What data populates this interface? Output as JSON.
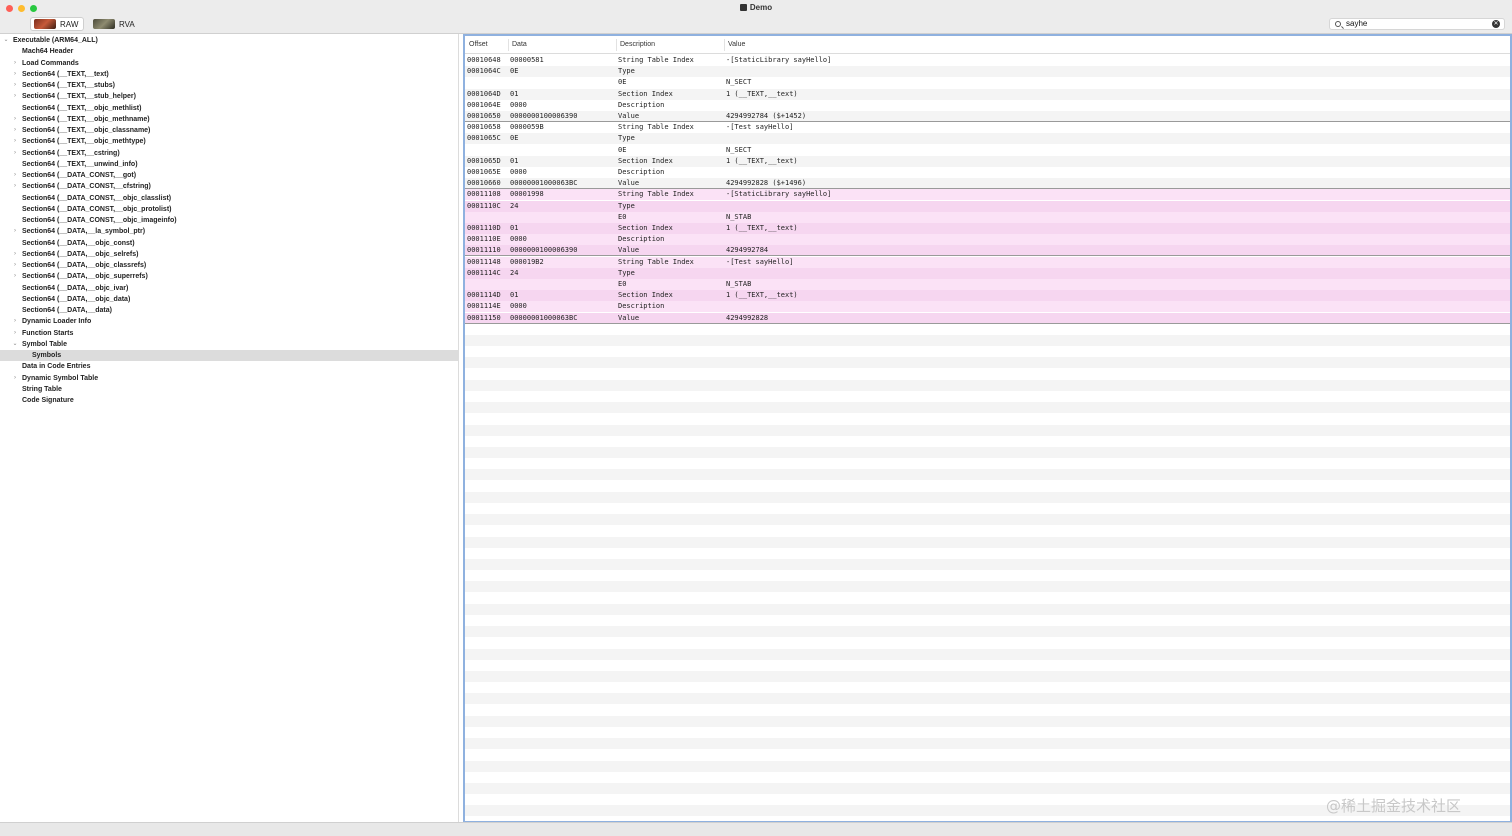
{
  "window": {
    "title": "Demo"
  },
  "toolbar": {
    "raw_label": "RAW",
    "rva_label": "RVA",
    "search_value": "sayhe"
  },
  "sidebar": {
    "items": [
      {
        "label": "Executable  (ARM64_ALL)",
        "expanded": true,
        "level": 0
      },
      {
        "label": "Mach64 Header",
        "level": 1
      },
      {
        "label": "Load Commands",
        "collapsed": true,
        "level": 1
      },
      {
        "label": "Section64 (__TEXT,__text)",
        "collapsed": true,
        "level": 1
      },
      {
        "label": "Section64 (__TEXT,__stubs)",
        "collapsed": true,
        "level": 1
      },
      {
        "label": "Section64 (__TEXT,__stub_helper)",
        "collapsed": true,
        "level": 1
      },
      {
        "label": "Section64 (__TEXT,__objc_methlist)",
        "level": 1
      },
      {
        "label": "Section64 (__TEXT,__objc_methname)",
        "collapsed": true,
        "level": 1
      },
      {
        "label": "Section64 (__TEXT,__objc_classname)",
        "collapsed": true,
        "level": 1
      },
      {
        "label": "Section64 (__TEXT,__objc_methtype)",
        "collapsed": true,
        "level": 1
      },
      {
        "label": "Section64 (__TEXT,__cstring)",
        "collapsed": true,
        "level": 1
      },
      {
        "label": "Section64 (__TEXT,__unwind_info)",
        "level": 1
      },
      {
        "label": "Section64 (__DATA_CONST,__got)",
        "collapsed": true,
        "level": 1
      },
      {
        "label": "Section64 (__DATA_CONST,__cfstring)",
        "collapsed": true,
        "level": 1
      },
      {
        "label": "Section64 (__DATA_CONST,__objc_classlist)",
        "level": 1
      },
      {
        "label": "Section64 (__DATA_CONST,__objc_protolist)",
        "level": 1
      },
      {
        "label": "Section64 (__DATA_CONST,__objc_imageinfo)",
        "level": 1
      },
      {
        "label": "Section64 (__DATA,__la_symbol_ptr)",
        "collapsed": true,
        "level": 1
      },
      {
        "label": "Section64 (__DATA,__objc_const)",
        "level": 1
      },
      {
        "label": "Section64 (__DATA,__objc_selrefs)",
        "collapsed": true,
        "level": 1
      },
      {
        "label": "Section64 (__DATA,__objc_classrefs)",
        "collapsed": true,
        "level": 1
      },
      {
        "label": "Section64 (__DATA,__objc_superrefs)",
        "collapsed": true,
        "level": 1
      },
      {
        "label": "Section64 (__DATA,__objc_ivar)",
        "level": 1
      },
      {
        "label": "Section64 (__DATA,__objc_data)",
        "level": 1
      },
      {
        "label": "Section64 (__DATA,__data)",
        "level": 1
      },
      {
        "label": "Dynamic Loader Info",
        "collapsed": true,
        "level": 1
      },
      {
        "label": "Function Starts",
        "collapsed": true,
        "level": 1
      },
      {
        "label": "Symbol Table",
        "expanded": true,
        "level": 1
      },
      {
        "label": "Symbols",
        "level": 2,
        "selected": true
      },
      {
        "label": "Data in Code Entries",
        "level": 1
      },
      {
        "label": "Dynamic Symbol Table",
        "collapsed": true,
        "level": 1
      },
      {
        "label": "String Table",
        "level": 1
      },
      {
        "label": "Code Signature",
        "level": 1
      }
    ]
  },
  "table": {
    "headers": {
      "offset": "Offset",
      "data": "Data",
      "description": "Description",
      "value": "Value"
    },
    "rows": [
      [
        "00010648",
        "00000581",
        "String Table Index",
        "-[StaticLibrary sayHello]"
      ],
      [
        "0001064C",
        "0E",
        "Type",
        ""
      ],
      [
        "",
        "",
        "0E",
        "N_SECT"
      ],
      [
        "0001064D",
        "01",
        "Section Index",
        "1 (__TEXT,__text)"
      ],
      [
        "0001064E",
        "0000",
        "Description",
        ""
      ],
      [
        "00010650",
        "0000000100006390",
        "Value",
        "4294992784 ($+1452)"
      ],
      [
        "00010658",
        "0000059B",
        "String Table Index",
        "-[Test sayHello]"
      ],
      [
        "0001065C",
        "0E",
        "Type",
        ""
      ],
      [
        "",
        "",
        "0E",
        "N_SECT"
      ],
      [
        "0001065D",
        "01",
        "Section Index",
        "1 (__TEXT,__text)"
      ],
      [
        "0001065E",
        "0000",
        "Description",
        ""
      ],
      [
        "00010660",
        "00000001000063BC",
        "Value",
        "4294992828 ($+1496)"
      ],
      [
        "00011108",
        "00001998",
        "String Table Index",
        "-[StaticLibrary sayHello]"
      ],
      [
        "0001110C",
        "24",
        "Type",
        ""
      ],
      [
        "",
        "",
        "E0",
        "N_STAB"
      ],
      [
        "0001110D",
        "01",
        "Section Index",
        "1 (__TEXT,__text)"
      ],
      [
        "0001110E",
        "0000",
        "Description",
        ""
      ],
      [
        "00011110",
        "0000000100006390",
        "Value",
        "4294992784"
      ],
      [
        "00011148",
        "000019B2",
        "String Table Index",
        "-[Test sayHello]"
      ],
      [
        "0001114C",
        "24",
        "Type",
        ""
      ],
      [
        "",
        "",
        "E0",
        "N_STAB"
      ],
      [
        "0001114D",
        "01",
        "Section Index",
        "1 (__TEXT,__text)"
      ],
      [
        "0001114E",
        "0000",
        "Description",
        ""
      ],
      [
        "00011150",
        "00000001000063BC",
        "Value",
        "4294992828"
      ]
    ],
    "highlight_color": "#fbe2f6"
  },
  "watermark": "@稀土掘金技术社区"
}
